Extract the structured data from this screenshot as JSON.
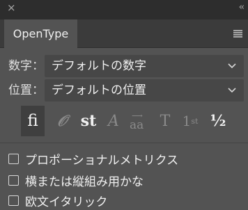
{
  "window": {
    "close_glyph": "×",
    "collapse_glyph": "‹‹"
  },
  "tab": {
    "label": "OpenType"
  },
  "numbers": {
    "label": "数字：",
    "value": "デフォルトの数字"
  },
  "position": {
    "label": "位置：",
    "value": "デフォルトの位置"
  },
  "glyph_buttons": [
    {
      "name": "ligatures",
      "text": "fi",
      "enabled": true
    },
    {
      "name": "swash",
      "text": "𝒪",
      "enabled": false
    },
    {
      "name": "discretionary-ligatures",
      "text": "st",
      "enabled": true
    },
    {
      "name": "titling-alternates",
      "text": "A",
      "enabled": false
    },
    {
      "name": "contextual-alternates",
      "text": "aa",
      "enabled": false
    },
    {
      "name": "stylistic-alternates",
      "text": "T",
      "enabled": false
    },
    {
      "name": "ordinal",
      "base": "1",
      "sup": "st",
      "enabled": false
    },
    {
      "name": "fractions",
      "text": "½",
      "enabled": true
    }
  ],
  "checkboxes": [
    {
      "label": "プロポーショナルメトリクス",
      "checked": false
    },
    {
      "label": "横または縦組み用かな",
      "checked": false
    },
    {
      "label": "欧文イタリック",
      "checked": false
    }
  ]
}
